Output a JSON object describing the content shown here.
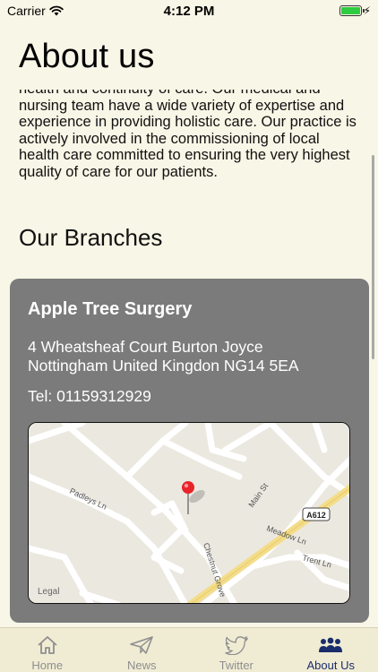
{
  "status_bar": {
    "carrier": "Carrier",
    "time": "4:12 PM"
  },
  "page": {
    "title": "About us"
  },
  "about": {
    "text": "health and continuity of care. Our medical and nursing team have a wide variety of expertise and experience in providing holistic care. Our practice is actively involved in the commissioning of local health care committed to ensuring the very highest quality of care for our patients."
  },
  "branches": {
    "title": "Our Branches",
    "items": [
      {
        "name": "Apple Tree Surgery",
        "address": "4 Wheatsheaf Court Burton Joyce Nottingham United Kingdon NG14 5EA",
        "tel": "Tel: 01159312929",
        "map": {
          "legal": "Legal",
          "streets": [
            "Main St",
            "Padleys Ln",
            "Meadow Ln",
            "Trent Ln",
            "Chestnut Grove"
          ],
          "road_badge": "A612"
        }
      }
    ]
  },
  "tabs": [
    {
      "label": "Home",
      "icon": "home-icon",
      "active": false
    },
    {
      "label": "News",
      "icon": "paper-plane-icon",
      "active": false
    },
    {
      "label": "Twitter",
      "icon": "twitter-bird-icon",
      "active": false
    },
    {
      "label": "About Us",
      "icon": "group-icon",
      "active": true
    }
  ],
  "colors": {
    "background": "#f8f6e6",
    "card": "#7b7b7b",
    "tab_active": "#1a2c6b",
    "tab_inactive": "#8e8e8e",
    "pin": "#e8232a"
  }
}
